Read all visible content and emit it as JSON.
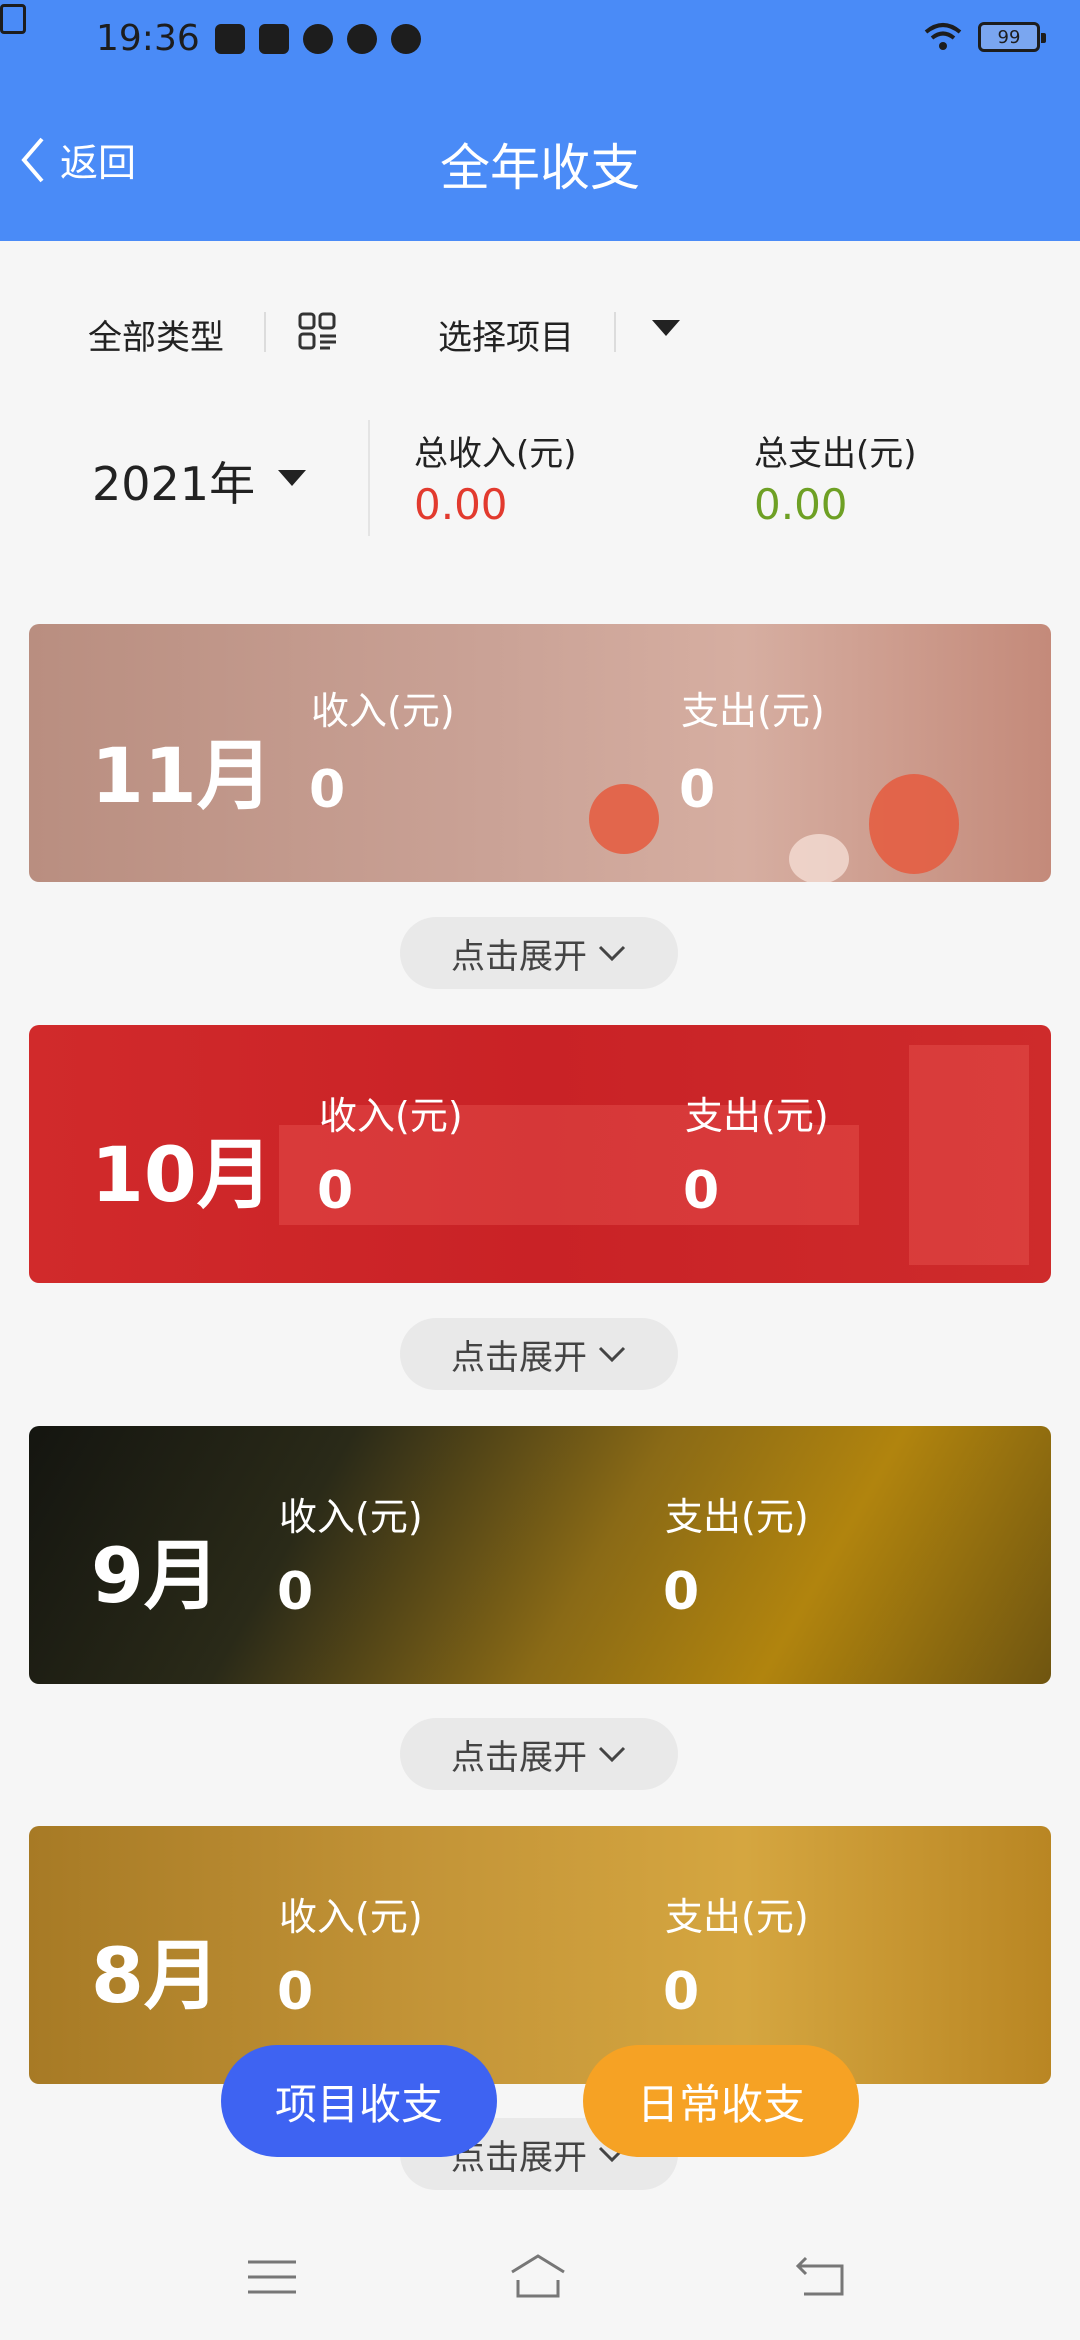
{
  "status_bar": {
    "time": "19:36",
    "battery": "99",
    "icons": [
      "sim-off-icon",
      "app-icon",
      "mail-icon",
      "cloud-icon",
      "compass-icon",
      "fan-icon",
      "wifi-icon",
      "battery-icon"
    ]
  },
  "header": {
    "back_label": "返回",
    "title": "全年收支",
    "color": "#4a8bf7"
  },
  "filters": {
    "type_label": "全部类型",
    "project_label": "选择项目"
  },
  "summary": {
    "year": "2021年",
    "income_label": "总收入(元)",
    "income_value": "0.00",
    "expense_label": "总支出(元)",
    "expense_value": "0.00",
    "income_color": "#e23a2e",
    "expense_color": "#6ea024"
  },
  "months": [
    {
      "month": "11月",
      "income_label": "收入(元)",
      "income": "0",
      "expense_label": "支出(元)",
      "expense": "0",
      "expand_label": "点击展开"
    },
    {
      "month": "10月",
      "income_label": "收入(元)",
      "income": "0",
      "expense_label": "支出(元)",
      "expense": "0",
      "expand_label": "点击展开"
    },
    {
      "month": "9月",
      "income_label": "收入(元)",
      "income": "0",
      "expense_label": "支出(元)",
      "expense": "0",
      "expand_label": "点击展开"
    },
    {
      "month": "8月",
      "income_label": "收入(元)",
      "income": "0",
      "expense_label": "支出(元)",
      "expense": "0",
      "expand_label": "点击展开"
    }
  ],
  "actions": {
    "project_label": "项目收支",
    "daily_label": "日常收支",
    "project_color": "#3e63f2",
    "daily_color": "#f6a224"
  },
  "bottom_nav": [
    "menu-icon",
    "home-icon",
    "back-icon"
  ]
}
